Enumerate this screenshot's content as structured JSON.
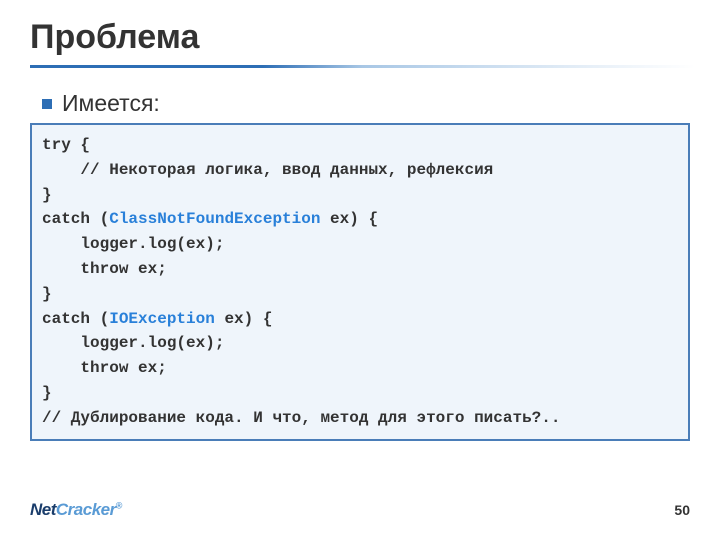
{
  "title": "Проблема",
  "bullet": "Имеется:",
  "code": {
    "l1": "try {",
    "l2": "    // Некоторая логика, ввод данных, рефлексия",
    "l3": "}",
    "l4a": "catch (",
    "l4b": "ClassNotFoundException",
    "l4c": " ex) {",
    "l5": "    logger.log(ex);",
    "l6": "    throw ex;",
    "l7": "}",
    "l8a": "catch (",
    "l8b": "IOException",
    "l8c": " ex) {",
    "l9": "    logger.log(ex);",
    "l10": "    throw ex;",
    "l11": "}",
    "l12": "// Дублирование кода. И что, метод для этого писать?.."
  },
  "logo": {
    "net": "Net",
    "cracker": "Cracker",
    "reg": "®"
  },
  "page": "50"
}
